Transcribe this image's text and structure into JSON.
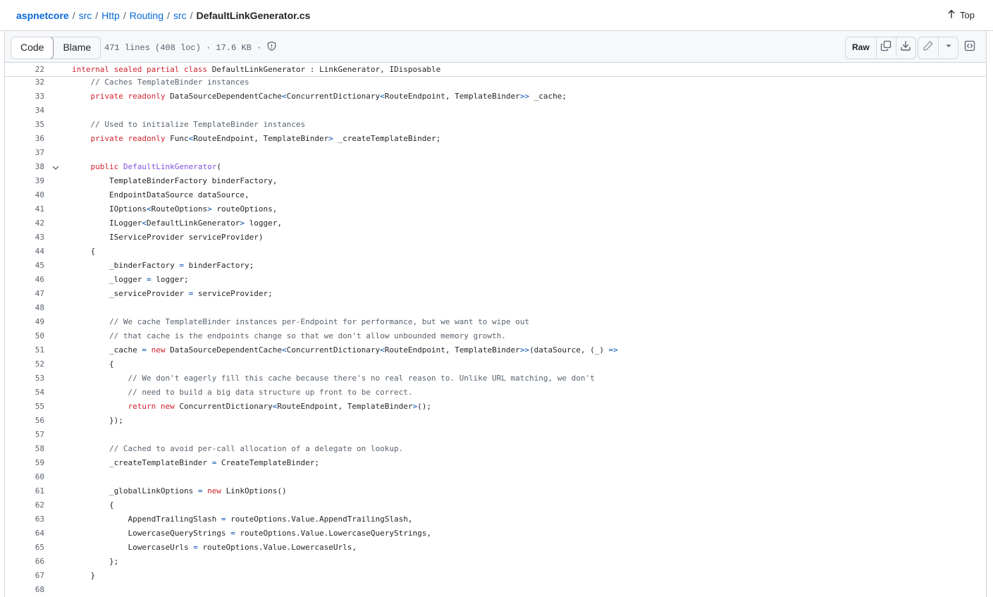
{
  "breadcrumb": {
    "repo": "aspnetcore",
    "segments": [
      "src",
      "Http",
      "Routing",
      "src"
    ],
    "file": "DefaultLinkGenerator.cs",
    "separator": "/"
  },
  "top_link": {
    "label": "Top",
    "icon": "arrow-up-icon"
  },
  "toolbar": {
    "code_tab": "Code",
    "blame_tab": "Blame",
    "file_info": "471 lines (408 loc) · 17.6 KB ·",
    "raw_label": "Raw",
    "icons": [
      "shield-icon",
      "copy-icon",
      "download-icon",
      "pencil-icon",
      "triangle-down-icon",
      "code-square-icon"
    ]
  },
  "sticky_line": {
    "number": "22",
    "tokens": [
      {
        "t": "internal sealed partial class ",
        "c": "kw"
      },
      {
        "t": "DefaultLinkGenerator : LinkGenerator, IDisposable",
        "c": ""
      }
    ]
  },
  "lines": [
    {
      "n": "32",
      "tokens": [
        {
          "t": "    // Caches TemplateBinder instances",
          "c": "cmt"
        }
      ]
    },
    {
      "n": "33",
      "tokens": [
        {
          "t": "    ",
          "c": ""
        },
        {
          "t": "private readonly ",
          "c": "kw"
        },
        {
          "t": "DataSourceDependentCache",
          "c": ""
        },
        {
          "t": "<",
          "c": "pun"
        },
        {
          "t": "ConcurrentDictionary",
          "c": ""
        },
        {
          "t": "<",
          "c": "pun"
        },
        {
          "t": "RouteEndpoint, TemplateBinder",
          "c": ""
        },
        {
          "t": ">>",
          "c": "pun"
        },
        {
          "t": " _cache;",
          "c": ""
        }
      ]
    },
    {
      "n": "34",
      "tokens": []
    },
    {
      "n": "35",
      "tokens": [
        {
          "t": "    // Used to initialize TemplateBinder instances",
          "c": "cmt"
        }
      ]
    },
    {
      "n": "36",
      "tokens": [
        {
          "t": "    ",
          "c": ""
        },
        {
          "t": "private readonly ",
          "c": "kw"
        },
        {
          "t": "Func",
          "c": ""
        },
        {
          "t": "<",
          "c": "pun"
        },
        {
          "t": "RouteEndpoint, TemplateBinder",
          "c": ""
        },
        {
          "t": ">",
          "c": "pun"
        },
        {
          "t": " _createTemplateBinder;",
          "c": ""
        }
      ]
    },
    {
      "n": "37",
      "tokens": []
    },
    {
      "n": "38",
      "fold": true,
      "tokens": [
        {
          "t": "    ",
          "c": ""
        },
        {
          "t": "public ",
          "c": "kw"
        },
        {
          "t": "DefaultLinkGenerator",
          "c": "ent"
        },
        {
          "t": "(",
          "c": ""
        }
      ]
    },
    {
      "n": "39",
      "tokens": [
        {
          "t": "        TemplateBinderFactory binderFactory,",
          "c": ""
        }
      ]
    },
    {
      "n": "40",
      "tokens": [
        {
          "t": "        EndpointDataSource dataSource,",
          "c": ""
        }
      ]
    },
    {
      "n": "41",
      "tokens": [
        {
          "t": "        IOptions",
          "c": ""
        },
        {
          "t": "<",
          "c": "pun"
        },
        {
          "t": "RouteOptions",
          "c": ""
        },
        {
          "t": ">",
          "c": "pun"
        },
        {
          "t": " routeOptions,",
          "c": ""
        }
      ]
    },
    {
      "n": "42",
      "tokens": [
        {
          "t": "        ILogger",
          "c": ""
        },
        {
          "t": "<",
          "c": "pun"
        },
        {
          "t": "DefaultLinkGenerator",
          "c": ""
        },
        {
          "t": ">",
          "c": "pun"
        },
        {
          "t": " logger,",
          "c": ""
        }
      ]
    },
    {
      "n": "43",
      "tokens": [
        {
          "t": "        IServiceProvider serviceProvider)",
          "c": ""
        }
      ]
    },
    {
      "n": "44",
      "tokens": [
        {
          "t": "    {",
          "c": ""
        }
      ]
    },
    {
      "n": "45",
      "tokens": [
        {
          "t": "        _binderFactory ",
          "c": ""
        },
        {
          "t": "=",
          "c": "pun"
        },
        {
          "t": " binderFactory;",
          "c": ""
        }
      ]
    },
    {
      "n": "46",
      "tokens": [
        {
          "t": "        _logger ",
          "c": ""
        },
        {
          "t": "=",
          "c": "pun"
        },
        {
          "t": " logger;",
          "c": ""
        }
      ]
    },
    {
      "n": "47",
      "tokens": [
        {
          "t": "        _serviceProvider ",
          "c": ""
        },
        {
          "t": "=",
          "c": "pun"
        },
        {
          "t": " serviceProvider;",
          "c": ""
        }
      ]
    },
    {
      "n": "48",
      "tokens": []
    },
    {
      "n": "49",
      "tokens": [
        {
          "t": "        // We cache TemplateBinder instances per-Endpoint for performance, but we want to wipe out",
          "c": "cmt"
        }
      ]
    },
    {
      "n": "50",
      "tokens": [
        {
          "t": "        // that cache is the endpoints change so that we don't allow unbounded memory growth.",
          "c": "cmt"
        }
      ]
    },
    {
      "n": "51",
      "tokens": [
        {
          "t": "        _cache ",
          "c": ""
        },
        {
          "t": "=",
          "c": "pun"
        },
        {
          "t": " ",
          "c": ""
        },
        {
          "t": "new ",
          "c": "kw"
        },
        {
          "t": "DataSourceDependentCache",
          "c": ""
        },
        {
          "t": "<",
          "c": "pun"
        },
        {
          "t": "ConcurrentDictionary",
          "c": ""
        },
        {
          "t": "<",
          "c": "pun"
        },
        {
          "t": "RouteEndpoint, TemplateBinder",
          "c": ""
        },
        {
          "t": ">>",
          "c": "pun"
        },
        {
          "t": "(dataSource, (_) ",
          "c": ""
        },
        {
          "t": "=>",
          "c": "pun"
        }
      ]
    },
    {
      "n": "52",
      "tokens": [
        {
          "t": "        {",
          "c": ""
        }
      ]
    },
    {
      "n": "53",
      "tokens": [
        {
          "t": "            // We don't eagerly fill this cache because there's no real reason to. Unlike URL matching, we don't",
          "c": "cmt"
        }
      ]
    },
    {
      "n": "54",
      "tokens": [
        {
          "t": "            // need to build a big data structure up front to be correct.",
          "c": "cmt"
        }
      ]
    },
    {
      "n": "55",
      "tokens": [
        {
          "t": "            ",
          "c": ""
        },
        {
          "t": "return new ",
          "c": "kw"
        },
        {
          "t": "ConcurrentDictionary",
          "c": ""
        },
        {
          "t": "<",
          "c": "pun"
        },
        {
          "t": "RouteEndpoint, TemplateBinder",
          "c": ""
        },
        {
          "t": ">",
          "c": "pun"
        },
        {
          "t": "();",
          "c": ""
        }
      ]
    },
    {
      "n": "56",
      "tokens": [
        {
          "t": "        });",
          "c": ""
        }
      ]
    },
    {
      "n": "57",
      "tokens": []
    },
    {
      "n": "58",
      "tokens": [
        {
          "t": "        // Cached to avoid per-call allocation of a delegate on lookup.",
          "c": "cmt"
        }
      ]
    },
    {
      "n": "59",
      "tokens": [
        {
          "t": "        _createTemplateBinder ",
          "c": ""
        },
        {
          "t": "=",
          "c": "pun"
        },
        {
          "t": " CreateTemplateBinder;",
          "c": ""
        }
      ]
    },
    {
      "n": "60",
      "tokens": []
    },
    {
      "n": "61",
      "tokens": [
        {
          "t": "        _globalLinkOptions ",
          "c": ""
        },
        {
          "t": "=",
          "c": "pun"
        },
        {
          "t": " ",
          "c": ""
        },
        {
          "t": "new ",
          "c": "kw"
        },
        {
          "t": "LinkOptions()",
          "c": ""
        }
      ]
    },
    {
      "n": "62",
      "tokens": [
        {
          "t": "        {",
          "c": ""
        }
      ]
    },
    {
      "n": "63",
      "tokens": [
        {
          "t": "            AppendTrailingSlash ",
          "c": ""
        },
        {
          "t": "=",
          "c": "pun"
        },
        {
          "t": " routeOptions.Value.AppendTrailingSlash,",
          "c": ""
        }
      ]
    },
    {
      "n": "64",
      "tokens": [
        {
          "t": "            LowercaseQueryStrings ",
          "c": ""
        },
        {
          "t": "=",
          "c": "pun"
        },
        {
          "t": " routeOptions.Value.LowercaseQueryStrings,",
          "c": ""
        }
      ]
    },
    {
      "n": "65",
      "tokens": [
        {
          "t": "            LowercaseUrls ",
          "c": ""
        },
        {
          "t": "=",
          "c": "pun"
        },
        {
          "t": " routeOptions.Value.LowercaseUrls,",
          "c": ""
        }
      ]
    },
    {
      "n": "66",
      "tokens": [
        {
          "t": "        };",
          "c": ""
        }
      ]
    },
    {
      "n": "67",
      "tokens": [
        {
          "t": "    }",
          "c": ""
        }
      ]
    },
    {
      "n": "68",
      "tokens": []
    }
  ]
}
